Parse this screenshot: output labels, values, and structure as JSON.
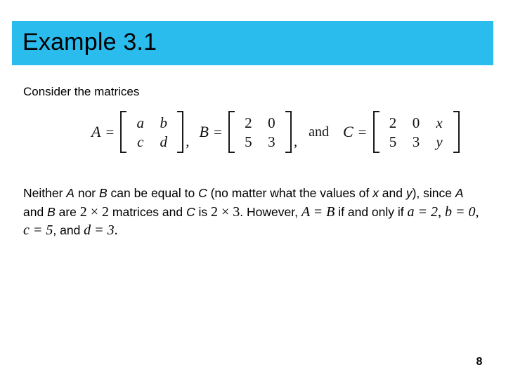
{
  "slide": {
    "title": "Example 3.1",
    "banner_color": "#2bbcee",
    "intro_text": "Consider the matrices",
    "page_number": "8"
  },
  "equation": {
    "matrices": [
      {
        "label": "A",
        "equals": "=",
        "rows": [
          [
            "a",
            "b"
          ],
          [
            "c",
            "d"
          ]
        ],
        "symbolic": true,
        "separator": ","
      },
      {
        "label": "B",
        "equals": "=",
        "rows": [
          [
            "2",
            "0"
          ],
          [
            "5",
            "3"
          ]
        ],
        "symbolic": false,
        "separator": ","
      },
      {
        "label": "C",
        "equals": "=",
        "rows": [
          [
            "2",
            "0",
            "x"
          ],
          [
            "5",
            "3",
            "y"
          ]
        ],
        "symbolic": false,
        "separator": ""
      }
    ],
    "conjunction": "and"
  },
  "paragraph": {
    "part1": "Neither ",
    "var_a1": "A",
    "part2": " nor ",
    "var_b1": "B",
    "part3": " can be equal to ",
    "var_c1": "C",
    "part4": " (no matter what the values of ",
    "var_x": "x",
    "part5": " and ",
    "var_y": "y",
    "part6": "), since ",
    "var_a2": "A",
    "part7": " and ",
    "var_b2": "B",
    "part8": " are ",
    "dim1": "2 × 2",
    "part9": " matrices and ",
    "var_c2": "C",
    "part10": " is ",
    "dim2": "2 × 3",
    "part11": ". However, ",
    "eq_ab": "A = B",
    "part12": " if and only if ",
    "eq_a": "a = 2",
    "comma1": ", ",
    "eq_b": "b = 0",
    "comma2": ", ",
    "eq_c": "c = 5",
    "part13": ", and ",
    "eq_d": "d = 3",
    "part14": "."
  }
}
